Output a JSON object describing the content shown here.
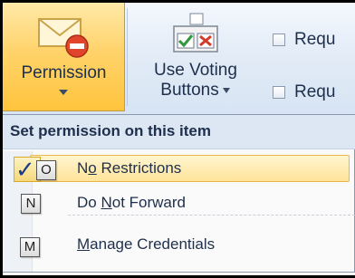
{
  "ribbon": {
    "permission_label": "Permission",
    "voting_line1": "Use Voting",
    "voting_line2": "Buttons",
    "request_1": "Requ",
    "request_2": "Requ"
  },
  "menu": {
    "header": "Set permission on this item",
    "items": [
      {
        "pre": "N",
        "acc": "o",
        "post": " Restrictions",
        "keytip": "O",
        "checked": true
      },
      {
        "pre": "Do ",
        "acc": "N",
        "post": "ot Forward",
        "keytip": "N",
        "checked": false
      },
      {
        "pre": "",
        "acc": "M",
        "post": "anage Credentials",
        "keytip": "M",
        "checked": false
      }
    ],
    "check_glyph": "✓"
  },
  "colors": {
    "accent_active": "#ffc43d",
    "ribbon_bg": "#dbe6f4",
    "menu_highlight": "#ffe49a"
  }
}
